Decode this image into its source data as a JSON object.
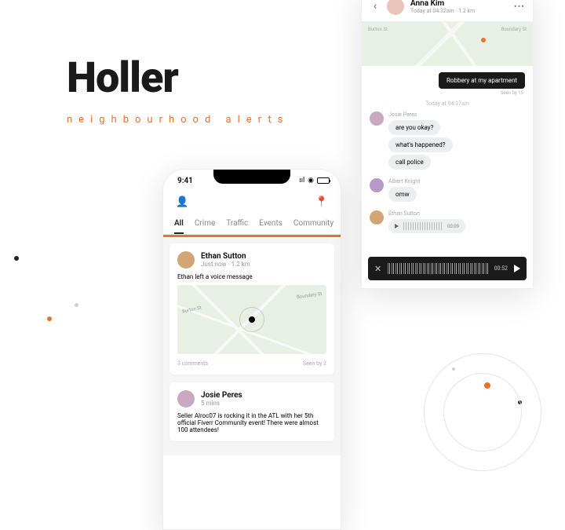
{
  "hero": {
    "title": "Holler",
    "tagline": "neighbourhood alerts"
  },
  "phone1": {
    "status_time": "9:41",
    "tabs": [
      "All",
      "Crime",
      "Traffic",
      "Events",
      "Community"
    ],
    "cards": [
      {
        "name": "Ethan Sutton",
        "meta": "Just now · 1.2 km",
        "msg": "Ethan left a voice message",
        "streets": [
          "Burton St",
          "Boundary St"
        ],
        "comments": "3 comments",
        "seen": "Seen by 2"
      },
      {
        "name": "Josie Peres",
        "meta": "5 mins",
        "msg": "Seller Alroc07 is rocking it in the ATL with her 5th official Fiverr Community event! There were almost 100 attendees!"
      }
    ]
  },
  "phone2": {
    "header": {
      "name": "Anna Kim",
      "meta": "Today at 04:32am · 1.2 km"
    },
    "map_streets": [
      "Burton St",
      "Boundary St"
    ],
    "alert": "Robbery at my apartment",
    "seen": "Seen by 15",
    "timestamp": "Today at 04:37am",
    "threads": [
      {
        "sender": "Josie Peres",
        "bubbles": [
          "are you okay?",
          "what's happened?",
          "call police"
        ]
      },
      {
        "sender": "Albert Knight",
        "bubbles": [
          "omw"
        ]
      },
      {
        "sender": "Ethan Sutton",
        "voice": "00:09"
      }
    ],
    "player_duration": "00:52"
  }
}
